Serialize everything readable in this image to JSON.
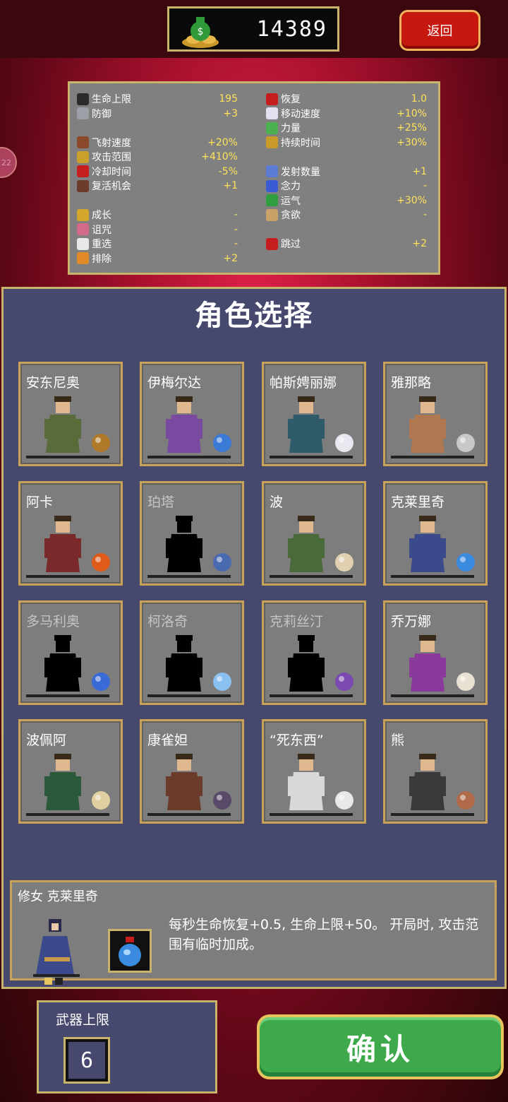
{
  "header": {
    "coins": "14389",
    "back_label": "返回",
    "side_badge": "22"
  },
  "stats": {
    "left": [
      {
        "name": "生命上限",
        "value": "195",
        "icon": "heart-icon",
        "color": "#2b2b2b"
      },
      {
        "name": "防御",
        "value": "+3",
        "icon": "armor-icon",
        "color": "#9aa0a6"
      },
      {
        "name": "飞射速度",
        "value": "+20%",
        "icon": "speed-book-icon",
        "color": "#8b4a2b"
      },
      {
        "name": "攻击范围",
        "value": "+410%",
        "icon": "area-icon",
        "color": "#c9a02a"
      },
      {
        "name": "冷却时间",
        "value": "-5%",
        "icon": "cooldown-icon",
        "color": "#c41e1e"
      },
      {
        "name": "复活机会",
        "value": "+1",
        "icon": "revival-icon",
        "color": "#6b3b2b"
      },
      {
        "name": "成长",
        "value": "-",
        "icon": "crown-icon",
        "color": "#d4a72c"
      },
      {
        "name": "诅咒",
        "value": "-",
        "icon": "skull-icon",
        "color": "#d46a8a"
      },
      {
        "name": "重选",
        "value": "-",
        "icon": "reroll-icon",
        "color": "#e8e8e8"
      },
      {
        "name": "排除",
        "value": "+2",
        "icon": "banish-icon",
        "color": "#e08a2a"
      }
    ],
    "right": [
      {
        "name": "恢复",
        "value": "1.0",
        "icon": "recovery-heart-icon",
        "color": "#c41e1e"
      },
      {
        "name": "移动速度",
        "value": "+10%",
        "icon": "wing-icon",
        "color": "#e0e0f0"
      },
      {
        "name": "力量",
        "value": "+25%",
        "icon": "leaf-icon",
        "color": "#4caf50"
      },
      {
        "name": "持续时间",
        "value": "+30%",
        "icon": "duration-icon",
        "color": "#c99a2a"
      },
      {
        "name": "发射数量",
        "value": "+1",
        "icon": "amount-icon",
        "color": "#5b7bd5"
      },
      {
        "name": "念力",
        "value": "-",
        "icon": "magnet-icon",
        "color": "#3b5bd5"
      },
      {
        "name": "运气",
        "value": "+30%",
        "icon": "clover-icon",
        "color": "#2e9e3e"
      },
      {
        "name": "贪欲",
        "value": "-",
        "icon": "greed-icon",
        "color": "#c9a26a"
      },
      {
        "name": "跳过",
        "value": "+2",
        "icon": "skip-icon",
        "color": "#c41e1e"
      }
    ]
  },
  "panel": {
    "title": "角色选择"
  },
  "characters": [
    {
      "name": "安东尼奥",
      "locked": false,
      "body": "#5a6b3a",
      "weapon": "whip-icon",
      "wcolor": "#b07a2a"
    },
    {
      "name": "伊梅尔达",
      "locked": false,
      "body": "#7a4aa0",
      "weapon": "magic-wand-icon",
      "wcolor": "#3a7ad5"
    },
    {
      "name": "帕斯娉丽娜",
      "locked": false,
      "body": "#2f5a6a",
      "weapon": "runetracer-icon",
      "wcolor": "#e8e8f0"
    },
    {
      "name": "雅那略",
      "locked": false,
      "body": "#b07850",
      "weapon": "knife-icon",
      "wcolor": "#c8c8c8"
    },
    {
      "name": "阿卡",
      "locked": false,
      "body": "#7a2a2a",
      "weapon": "fire-wand-icon",
      "wcolor": "#e05a1a"
    },
    {
      "name": "珀塔",
      "locked": true,
      "body": "#000000",
      "weapon": "lightning-ring-icon",
      "wcolor": "#4a6ab0"
    },
    {
      "name": "波",
      "locked": false,
      "body": "#4a6a3a",
      "weapon": "garlic-icon",
      "wcolor": "#e0d0b0"
    },
    {
      "name": "克莱里奇",
      "locked": false,
      "body": "#3a4a8a",
      "weapon": "santa-water-icon",
      "wcolor": "#3a8ae0"
    },
    {
      "name": "多马利奥",
      "locked": true,
      "body": "#000000",
      "weapon": "king-bible-icon",
      "wcolor": "#3a6ad5"
    },
    {
      "name": "柯洛奇",
      "locked": true,
      "body": "#000000",
      "weapon": "cross-icon",
      "wcolor": "#8ac0f0"
    },
    {
      "name": "克莉丝汀",
      "locked": true,
      "body": "#000000",
      "weapon": "pentagram-icon",
      "wcolor": "#7a4ab0"
    },
    {
      "name": "乔万娜",
      "locked": false,
      "body": "#8a3a9a",
      "weapon": "peachone-icon",
      "wcolor": "#e8e0d0"
    },
    {
      "name": "波佩阿",
      "locked": false,
      "body": "#2a5a3a",
      "weapon": "song-scroll-icon",
      "wcolor": "#e0d0a0"
    },
    {
      "name": "康雀妲",
      "locked": false,
      "body": "#6a3a2a",
      "weapon": "gatti-icon",
      "wcolor": "#5a4a6a"
    },
    {
      "name": "“死东西”",
      "locked": false,
      "body": "#d8d8d8",
      "weapon": "bone-icon",
      "wcolor": "#e8e8e8"
    },
    {
      "name": "熊",
      "locked": false,
      "body": "#3a3a3a",
      "weapon": "cherry-bomb-icon",
      "wcolor": "#b06a4a"
    }
  ],
  "selected": {
    "title": "修女 克莱里奇",
    "description": "每秒生命恢复+0.5, 生命上限+50。 开局时, 攻击范围有临时加成。",
    "weapon_icon": "santa-water-icon"
  },
  "weapon_limit": {
    "label": "武器上限",
    "value": "6"
  },
  "confirm_label": "确认",
  "colors": {
    "panel_bg": "#46486e",
    "border_gold": "#c9b46c",
    "value_yellow": "#ffe35a",
    "confirm_green": "#3da94a",
    "back_red": "#c6180f"
  }
}
